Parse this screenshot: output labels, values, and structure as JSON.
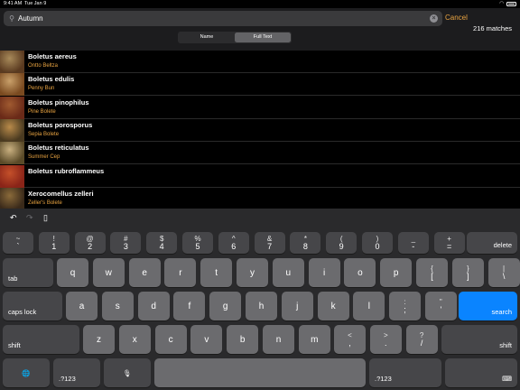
{
  "status": {
    "time": "9:41 AM",
    "date": "Tue Jan 9",
    "battery": "100%"
  },
  "search": {
    "value": "Autumn",
    "cancel_label": "Cancel",
    "match_count": "216 matches"
  },
  "scope": {
    "options": [
      "Name",
      "Full Text"
    ],
    "selected": "Full Text"
  },
  "results": [
    {
      "title": "Boletus aereus",
      "subtitle": "Ontto Beltza",
      "colors": [
        "#5a3a20",
        "#a88a5a"
      ]
    },
    {
      "title": "Boletus edulis",
      "subtitle": "Penny Bun",
      "colors": [
        "#7a4a20",
        "#c9a06a"
      ]
    },
    {
      "title": "Boletus pinophilus",
      "subtitle": "Pine Bolete",
      "colors": [
        "#6a2a18",
        "#a05a30"
      ]
    },
    {
      "title": "Boletus porosporus",
      "subtitle": "Sepia Bolete",
      "colors": [
        "#4a3a20",
        "#b88a4a"
      ]
    },
    {
      "title": "Boletus reticulatus",
      "subtitle": "Summer Cep",
      "colors": [
        "#5a4a28",
        "#c9b080"
      ]
    },
    {
      "title": "Boletus rubroflammeus",
      "subtitle": "",
      "colors": [
        "#8a2418",
        "#c4502a"
      ]
    },
    {
      "title": "Xerocomellus zelleri",
      "subtitle": "Zeller's Bolete",
      "colors": [
        "#3a2a1a",
        "#8a6a3a"
      ]
    }
  ],
  "toolbar": {
    "undo": "↶",
    "redo": "↷",
    "paste": "▯"
  },
  "keyboard": {
    "row1": [
      [
        "~",
        "`"
      ],
      [
        "!",
        "1"
      ],
      [
        "@",
        "2"
      ],
      [
        "#",
        "3"
      ],
      [
        "$",
        "4"
      ],
      [
        "%",
        "5"
      ],
      [
        "^",
        "6"
      ],
      [
        "&",
        "7"
      ],
      [
        "*",
        "8"
      ],
      [
        "(",
        "9"
      ],
      [
        ")",
        "0"
      ],
      [
        "_",
        "-"
      ],
      [
        "+",
        "="
      ]
    ],
    "delete": "delete",
    "tab": "tab",
    "row2": [
      "q",
      "w",
      "e",
      "r",
      "t",
      "y",
      "u",
      "i",
      "o",
      "p"
    ],
    "row2_sym": [
      [
        "{",
        "["
      ],
      [
        "}",
        "]"
      ],
      [
        "|",
        "\\"
      ]
    ],
    "caps": "caps lock",
    "row3": [
      "a",
      "s",
      "d",
      "f",
      "g",
      "h",
      "j",
      "k",
      "l"
    ],
    "row3_sym": [
      [
        ":",
        ";"
      ],
      [
        "\"",
        "'"
      ]
    ],
    "search_key": "search",
    "shift": "shift",
    "row4": [
      "z",
      "x",
      "c",
      "v",
      "b",
      "n",
      "m"
    ],
    "row4_sym": [
      [
        "<",
        ","
      ],
      [
        ">",
        "."
      ],
      [
        "?",
        "/"
      ]
    ],
    "numbers": ".?123",
    "globe": "🌐",
    "mic": "🎙",
    "hide": "⌨"
  },
  "colors": {
    "accent": "#e8a341",
    "search_blue": "#0a84ff"
  }
}
